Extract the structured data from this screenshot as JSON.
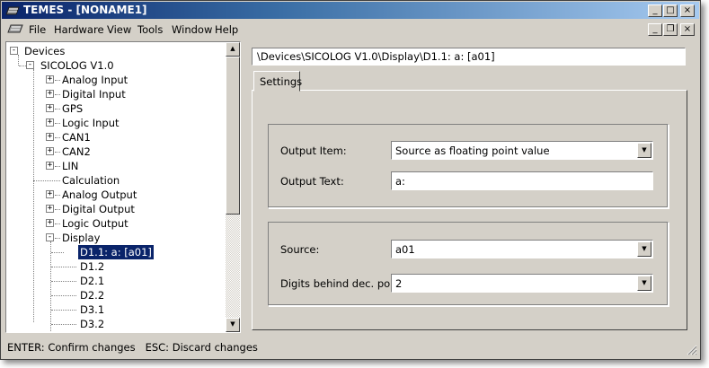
{
  "window": {
    "title": "TEMES - [NONAME1]",
    "caption_buttons": [
      "_",
      "□",
      "×"
    ],
    "mdi_buttons": [
      "_",
      "❐",
      "×"
    ]
  },
  "menu": [
    "File",
    "Hardware",
    "View",
    "Tools",
    "Window",
    "Help"
  ],
  "tree": [
    {
      "label": "Devices",
      "expander": "-"
    },
    {
      "label": "SICOLOG V1.0",
      "expander": "-"
    },
    {
      "label": "Analog Input",
      "expander": "+"
    },
    {
      "label": "Digital Input",
      "expander": "+"
    },
    {
      "label": "GPS",
      "expander": "+"
    },
    {
      "label": "Logic Input",
      "expander": "+"
    },
    {
      "label": "CAN1",
      "expander": "+"
    },
    {
      "label": "CAN2",
      "expander": "+"
    },
    {
      "label": "LIN",
      "expander": "+"
    },
    {
      "label": "Calculation",
      "expander": ""
    },
    {
      "label": "Analog Output",
      "expander": "+"
    },
    {
      "label": "Digital Output",
      "expander": "+"
    },
    {
      "label": "Logic Output",
      "expander": "+"
    },
    {
      "label": "Display",
      "expander": "-"
    },
    {
      "label": "D1.1: a: [a01]",
      "expander": "",
      "selected": true
    },
    {
      "label": "D1.2",
      "expander": ""
    },
    {
      "label": "D2.1",
      "expander": ""
    },
    {
      "label": "D2.2",
      "expander": ""
    },
    {
      "label": "D3.1",
      "expander": ""
    },
    {
      "label": "D3.2",
      "expander": ""
    }
  ],
  "path": "\\Devices\\SICOLOG V1.0\\Display\\D1.1: a: [a01]",
  "tab": "Settings",
  "form": {
    "output_item": {
      "label": "Output Item:",
      "value": "Source as floating point value"
    },
    "output_text": {
      "label": "Output Text:",
      "value": "a:"
    },
    "source": {
      "label": "Source:",
      "value": "a01"
    },
    "digits": {
      "label": "Digits behind dec. point:",
      "value": "2"
    }
  },
  "status": "ENTER: Confirm changes   ESC: Discard changes",
  "colors": {
    "title_start": "#0a246a",
    "title_end": "#a6caf0",
    "face": "#d4d0c8",
    "selection": "#0a246a"
  }
}
